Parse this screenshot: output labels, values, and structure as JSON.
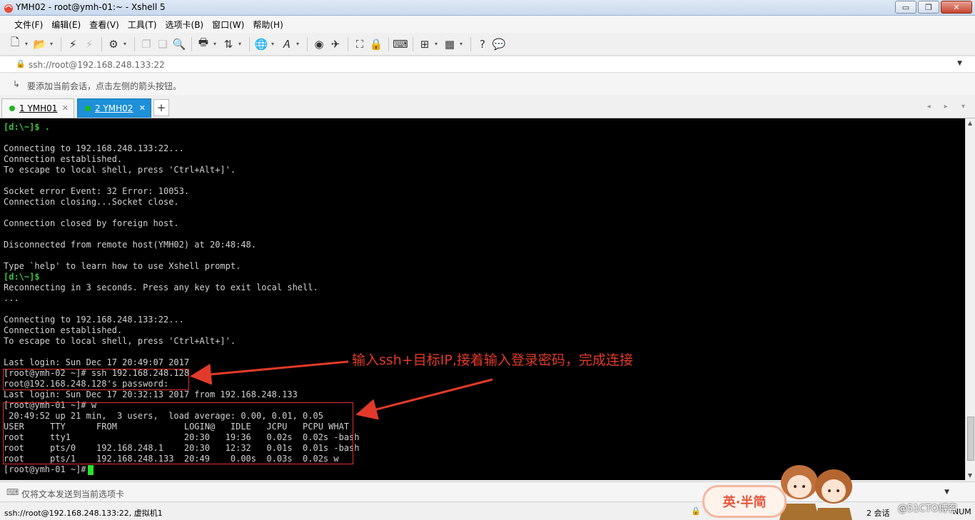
{
  "window": {
    "title": "YMH02 - root@ymh-01:~ - Xshell 5",
    "buttons": {
      "minimize": "▭",
      "maximize": "❐",
      "close": "✕"
    }
  },
  "menu": [
    "文件(F)",
    "编辑(E)",
    "查看(V)",
    "工具(T)",
    "选项卡(B)",
    "窗口(W)",
    "帮助(H)"
  ],
  "toolbar": {
    "icons": [
      "new-session-icon",
      "open-folder-icon",
      "reconnect-icon",
      "disconnect-icon",
      "properties-icon",
      "copy-icon",
      "paste-icon",
      "find-icon",
      "print-icon",
      "transfer-icon",
      "globe-icon",
      "font-icon",
      "xftp-icon",
      "xmanager-icon",
      "fullscreen-icon",
      "lock-icon",
      "keyboard-icon",
      "new-tab-icon",
      "layout-icon",
      "help-icon",
      "chat-icon"
    ]
  },
  "address": {
    "value": "ssh://root@192.168.248.133:22"
  },
  "hint": {
    "text": "要添加当前会话，点击左侧的箭头按钮。"
  },
  "tabs": [
    {
      "label": "1 YMH01",
      "active": false,
      "status_color": "#1fb81f"
    },
    {
      "label": "2 YMH02",
      "active": true,
      "status_color": "#1fb81f"
    }
  ],
  "tab_add": "+",
  "tab_nav": "◂ ▸ ▾",
  "terminal": {
    "lines": [
      "[d:\\~]$ .",
      "",
      "Connecting to 192.168.248.133:22...",
      "Connection established.",
      "To escape to local shell, press 'Ctrl+Alt+]'.",
      "",
      "Socket error Event: 32 Error: 10053.",
      "Connection closing...Socket close.",
      "",
      "Connection closed by foreign host.",
      "",
      "Disconnected from remote host(YMH02) at 20:48:48.",
      "",
      "Type `help' to learn how to use Xshell prompt.",
      "[d:\\~]$",
      "Reconnecting in 3 seconds. Press any key to exit local shell.",
      "...",
      "",
      "Connecting to 192.168.248.133:22...",
      "Connection established.",
      "To escape to local shell, press 'Ctrl+Alt+]'.",
      "",
      "Last login: Sun Dec 17 20:49:07 2017",
      "[root@ymh-02 ~]# ssh 192.168.248.128",
      "root@192.168.248.128's password:",
      "Last login: Sun Dec 17 20:32:13 2017 from 192.168.248.133",
      "[root@ymh-01 ~]# w",
      " 20:49:52 up 21 min,  3 users,  load average: 0.00, 0.01, 0.05",
      "USER     TTY      FROM             LOGIN@   IDLE   JCPU   PCPU WHAT",
      "root     tty1                      20:30   19:36   0.02s  0.02s -bash",
      "root     pts/0    192.168.248.1    20:30   12:32   0.01s  0.01s -bash",
      "root     pts/1    192.168.248.133  20:49    0.00s  0.03s  0.02s w",
      "[root@ymh-01 ~]# "
    ],
    "annotation": "输入ssh+目标IP,接着输入登录密码，完成连接",
    "annotation_color": "#e23a2a",
    "bg_color": "#000000",
    "text_color": "#d0d0d0",
    "prompt_color": "#3ec53e"
  },
  "sendbar": {
    "text": "仅将文本发送到当前选项卡"
  },
  "status": {
    "connection": "ssh://root@192.168.248.133:22, 虚拟机1",
    "sessions": "2 会话",
    "num": "NUM"
  },
  "ime": {
    "label": "英·半简"
  },
  "watermark": "@51CTO博客"
}
